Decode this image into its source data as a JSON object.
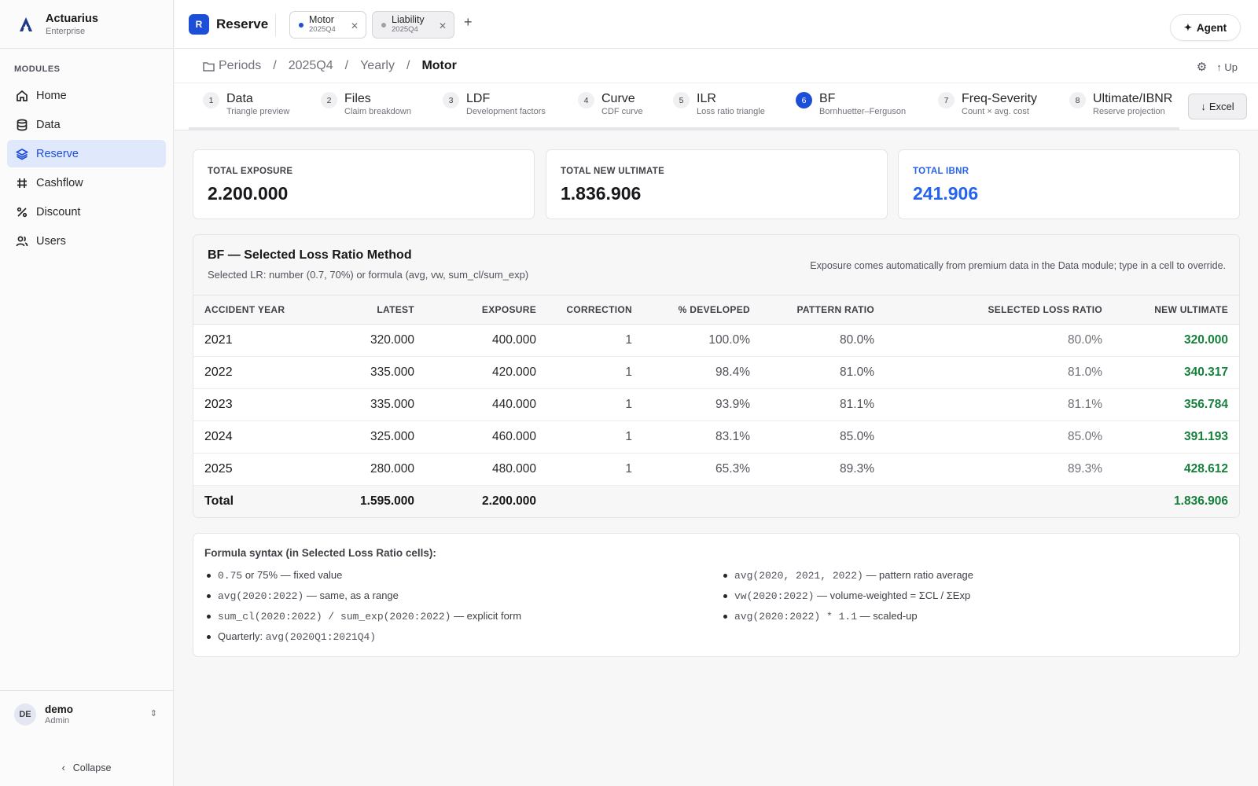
{
  "brand": {
    "name": "Actuarius",
    "sub": "Enterprise"
  },
  "sidebar": {
    "section_label": "MODULES",
    "items": [
      {
        "label": "Home",
        "icon": "home-icon",
        "active": false
      },
      {
        "label": "Data",
        "icon": "database-icon",
        "active": false
      },
      {
        "label": "Reserve",
        "icon": "layers-icon",
        "active": true
      },
      {
        "label": "Cashflow",
        "icon": "grid-icon",
        "active": false
      },
      {
        "label": "Discount",
        "icon": "percent-icon",
        "active": false
      },
      {
        "label": "Users",
        "icon": "users-icon",
        "active": false
      }
    ],
    "user": {
      "initials": "DE",
      "name": "demo",
      "role": "Admin"
    },
    "collapse_label": "Collapse"
  },
  "topbar": {
    "app_badge": "R",
    "app_title": "Reserve",
    "file_tabs": [
      {
        "name": "Motor",
        "period": "2025Q4",
        "active": true,
        "dot_color": "#1d4ed8"
      },
      {
        "name": "Liability",
        "period": "2025Q4",
        "active": false,
        "dot_color": "#a1a1aa"
      }
    ],
    "add_tab": "+",
    "agent_label": "Agent"
  },
  "breadcrumb": {
    "items": [
      "Periods",
      "2025Q4",
      "Yearly",
      "Motor"
    ],
    "separator": "/",
    "up_label": "Up"
  },
  "steps": [
    {
      "num": "1",
      "name": "Data",
      "sub": "Triangle preview"
    },
    {
      "num": "2",
      "name": "Files",
      "sub": "Claim breakdown"
    },
    {
      "num": "3",
      "name": "LDF",
      "sub": "Development factors"
    },
    {
      "num": "4",
      "name": "Curve",
      "sub": "CDF curve"
    },
    {
      "num": "5",
      "name": "ILR",
      "sub": "Loss ratio triangle"
    },
    {
      "num": "6",
      "name": "BF",
      "sub": "Bornhuetter–Ferguson",
      "active": true
    },
    {
      "num": "7",
      "name": "Freq-Severity",
      "sub": "Count × avg. cost"
    },
    {
      "num": "8",
      "name": "Ultimate/IBNR",
      "sub": "Reserve projection"
    }
  ],
  "excel_label": "Excel",
  "kpis": [
    {
      "label": "TOTAL EXPOSURE",
      "value": "2.200.000"
    },
    {
      "label": "TOTAL NEW ULTIMATE",
      "value": "1.836.906"
    },
    {
      "label": "TOTAL IBNR",
      "value": "241.906"
    }
  ],
  "bf_table": {
    "title": "BF — Selected Loss Ratio Method",
    "subtitle": "Selected LR: number (0.7, 70%) or formula (avg, vw, sum_cl/sum_exp)",
    "note": "Exposure comes automatically from premium data in the Data module; type in a cell to override.",
    "columns": [
      "ACCIDENT YEAR",
      "LATEST",
      "EXPOSURE",
      "CORRECTION",
      "% DEVELOPED",
      "PATTERN RATIO",
      "SELECTED LOSS RATIO",
      "NEW ULTIMATE"
    ],
    "rows": [
      {
        "year": "2021",
        "latest": "320.000",
        "exposure": "400.000",
        "correction": "1",
        "developed": "100.0%",
        "pattern": "80.0%",
        "selected": "80.0%",
        "ultimate": "320.000"
      },
      {
        "year": "2022",
        "latest": "335.000",
        "exposure": "420.000",
        "correction": "1",
        "developed": "98.4%",
        "pattern": "81.0%",
        "selected": "81.0%",
        "ultimate": "340.317"
      },
      {
        "year": "2023",
        "latest": "335.000",
        "exposure": "440.000",
        "correction": "1",
        "developed": "93.9%",
        "pattern": "81.1%",
        "selected": "81.1%",
        "ultimate": "356.784"
      },
      {
        "year": "2024",
        "latest": "325.000",
        "exposure": "460.000",
        "correction": "1",
        "developed": "83.1%",
        "pattern": "85.0%",
        "selected": "85.0%",
        "ultimate": "391.193"
      },
      {
        "year": "2025",
        "latest": "280.000",
        "exposure": "480.000",
        "correction": "1",
        "developed": "65.3%",
        "pattern": "89.3%",
        "selected": "89.3%",
        "ultimate": "428.612"
      }
    ],
    "total": {
      "label": "Total",
      "latest": "1.595.000",
      "exposure": "2.200.000",
      "ultimate": "1.836.906"
    }
  },
  "formula": {
    "title": "Formula syntax (in Selected Loss Ratio cells):",
    "left": [
      {
        "code": "0.75",
        "text": " or 75% — fixed value"
      },
      {
        "code": "avg(2020:2022)",
        "text": " — same, as a range"
      },
      {
        "code": "sum_cl(2020:2022) / sum_exp(2020:2022)",
        "text": " — explicit form"
      },
      {
        "prefix": "Quarterly: ",
        "code": "avg(2020Q1:2021Q4)",
        "text": ""
      }
    ],
    "right": [
      {
        "code": "avg(2020, 2021, 2022)",
        "text": " — pattern ratio average"
      },
      {
        "code": "vw(2020:2022)",
        "text": " — volume-weighted = ΣCL / ΣExp"
      },
      {
        "code": "avg(2020:2022) * 1.1",
        "text": " — scaled-up"
      }
    ]
  }
}
